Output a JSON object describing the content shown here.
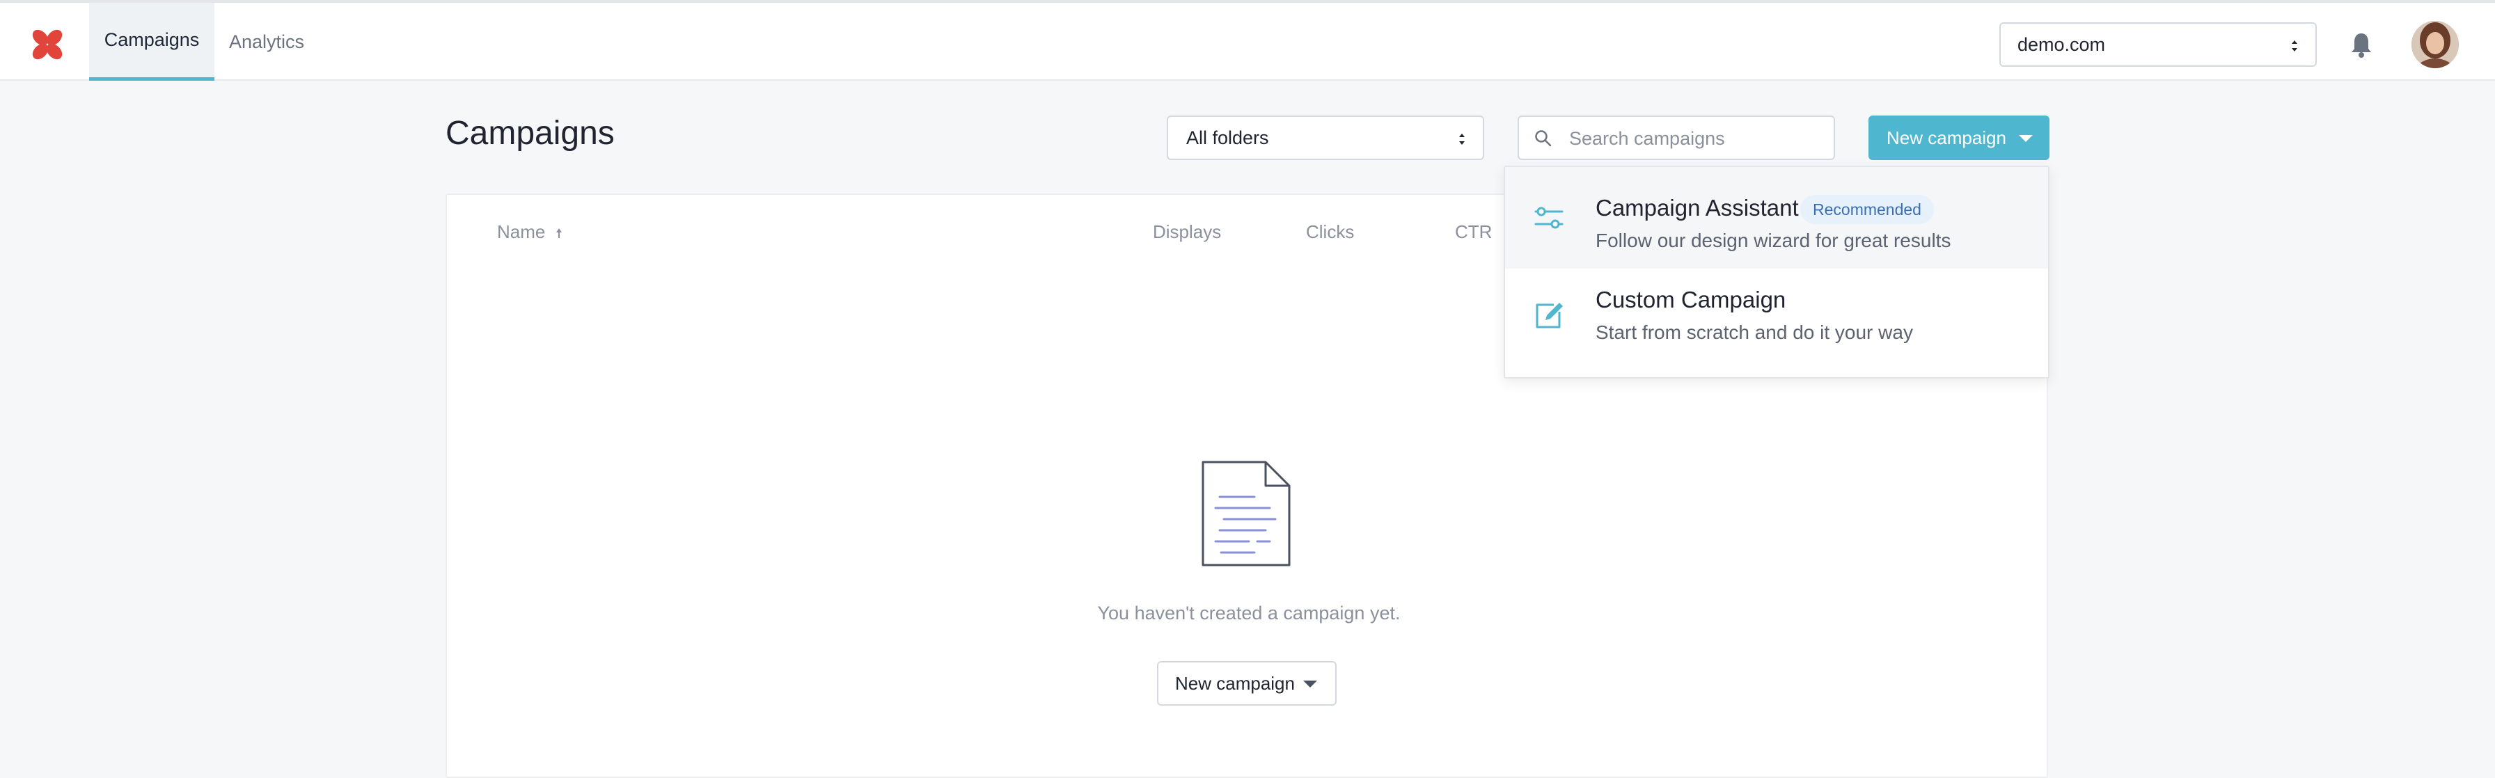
{
  "nav": {
    "tabs": [
      {
        "label": "Campaigns",
        "active": true
      },
      {
        "label": "Analytics",
        "active": false
      }
    ],
    "domain_select": "demo.com"
  },
  "header": {
    "title": "Campaigns",
    "folder_select": "All folders",
    "search_placeholder": "Search campaigns",
    "new_button": "New campaign"
  },
  "table": {
    "columns": [
      "Name",
      "Displays",
      "Clicks",
      "CTR"
    ],
    "sort_column": "Name",
    "sort_direction": "ascending"
  },
  "empty_state": {
    "message": "You haven't created a campaign yet.",
    "button": "New campaign"
  },
  "dropdown": {
    "items": [
      {
        "title": "Campaign Assistant",
        "badge": "Recommended",
        "subtitle": "Follow our design wizard for great results",
        "icon": "sliders-icon"
      },
      {
        "title": "Custom Campaign",
        "subtitle": "Start from scratch and do it your way",
        "icon": "edit-icon"
      }
    ]
  },
  "colors": {
    "accent": "#4fb6cf",
    "logo": "#e0443a",
    "badge_bg": "#e6f1fb",
    "badge_text": "#3a6fb5"
  }
}
